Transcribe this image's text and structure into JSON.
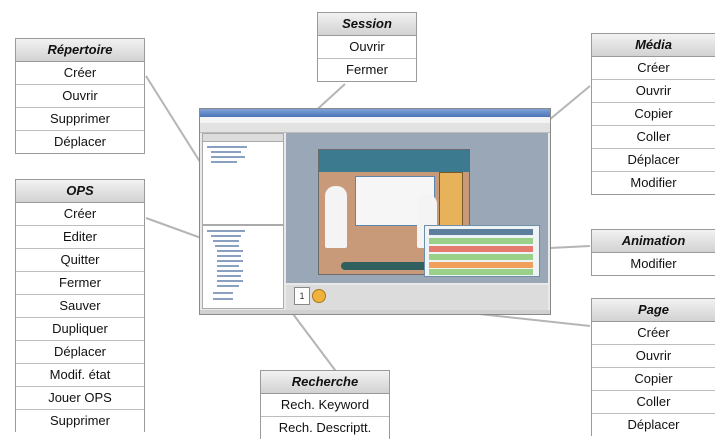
{
  "panels": {
    "session": {
      "title": "Session",
      "items": [
        "Ouvrir",
        "Fermer"
      ]
    },
    "repertoire": {
      "title": "Répertoire",
      "items": [
        "Créer",
        "Ouvrir",
        "Supprimer",
        "Déplacer"
      ]
    },
    "ops": {
      "title": "OPS",
      "items": [
        "Créer",
        "Editer",
        "Quitter",
        "Fermer",
        "Sauver",
        "Dupliquer",
        "Déplacer",
        "Modif. état",
        "Jouer OPS",
        "Supprimer"
      ]
    },
    "media": {
      "title": "Média",
      "items": [
        "Créer",
        "Ouvrir",
        "Copier",
        "Coller",
        "Déplacer",
        "Modifier"
      ]
    },
    "animation": {
      "title": "Animation",
      "items": [
        "Modifier"
      ]
    },
    "page": {
      "title": "Page",
      "items": [
        "Créer",
        "Ouvrir",
        "Copier",
        "Coller",
        "Déplacer"
      ]
    },
    "recherche": {
      "title": "Recherche",
      "items": [
        "Rech. Keyword",
        "Rech. Descriptt."
      ]
    }
  },
  "screenshot": {
    "page_number": "1"
  },
  "colors": {
    "panel_border": "#9a9a9a",
    "leader_line": "#b5b5b5",
    "header_fill": "#dcdcdc"
  }
}
